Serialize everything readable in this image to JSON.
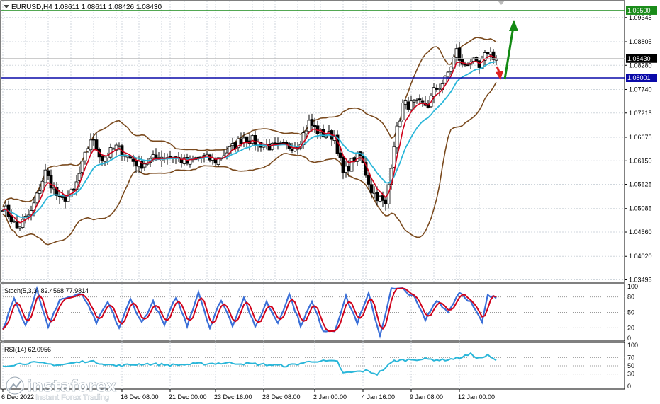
{
  "header": {
    "symbol_info": "EURUSD,H4  1.08611 1.08611 1.08426 1.08430"
  },
  "logo": {
    "brand": "instaforex",
    "tagline": "Instant Forex Trading"
  },
  "colors": {
    "grid": "#cfd6dc",
    "frame": "#000000",
    "bull": "#000000",
    "bear": "#000000",
    "ema_fast": "#d0021b",
    "ema_slow": "#29b6d9",
    "bb": "#7a4a1e",
    "resistance": "#1a8c1a",
    "support": "#0a0aa8",
    "stoch_main": "#3a6fd8",
    "stoch_signal": "#d0021b",
    "rsi": "#29b6d9",
    "arrow_up": "#138a13",
    "arrow_down": "#e02020"
  },
  "price_axis": {
    "ticks": [
      "1.09345",
      "1.08805",
      "1.08280",
      "1.07740",
      "1.07215",
      "1.06675",
      "1.06150",
      "1.05625",
      "1.05085",
      "1.04560",
      "1.04020",
      "1.03495"
    ],
    "tick_values": [
      1.09345,
      1.08805,
      1.0828,
      1.0774,
      1.07215,
      1.06675,
      1.0615,
      1.05625,
      1.05085,
      1.0456,
      1.0402,
      1.03495
    ],
    "ylim": [
      1.0344,
      1.0972
    ]
  },
  "levels": {
    "resistance": {
      "value": 1.095,
      "label": "1.09500"
    },
    "current": {
      "value": 1.0843,
      "label": "1.08430"
    },
    "support": {
      "value": 1.08,
      "label": "1.08001"
    }
  },
  "time_axis": {
    "labels": [
      "6 Dec 2022",
      "16 Dec 08:00",
      "21 Dec 00:00",
      "23 Dec 16:00",
      "28 Dec 08:00",
      "2 Jan 00:00",
      "4 Jan 16:00",
      "9 Jan 08:00",
      "12 Jan 00:00"
    ],
    "positions": [
      0,
      42,
      59,
      75,
      92,
      110,
      127,
      144,
      161
    ]
  },
  "stoch": {
    "label": "Stoch(5,3,3) 82.4568 77.9814",
    "ticks": [
      "100",
      "80",
      "50",
      "20",
      "0"
    ],
    "tick_values": [
      100,
      80,
      50,
      20,
      0
    ]
  },
  "rsi": {
    "label": "RSI(14) 62.0956",
    "ticks": [
      "100",
      "70",
      "50",
      "30",
      "0"
    ],
    "tick_values": [
      100,
      70,
      50,
      30,
      0
    ]
  },
  "chart_data": {
    "type": "candlestick",
    "title": "EURUSD,H4",
    "bars": 175,
    "close_anchor_idx": [
      0,
      5,
      10,
      15,
      20,
      25,
      31,
      35,
      40,
      44,
      48,
      55,
      60,
      65,
      70,
      75,
      80,
      85,
      90,
      95,
      100,
      104,
      108,
      112,
      117,
      120,
      124,
      126,
      130,
      135,
      138,
      141,
      145,
      150,
      152,
      156,
      160,
      162,
      165,
      168,
      171,
      174
    ],
    "close_anchor_val": [
      1.0515,
      1.0465,
      1.05,
      1.059,
      1.0525,
      1.0545,
      1.0665,
      1.062,
      1.0645,
      1.0625,
      1.0605,
      1.0625,
      1.0625,
      1.061,
      1.0625,
      1.0615,
      1.064,
      1.0668,
      1.0655,
      1.0645,
      1.0645,
      1.065,
      1.07,
      1.0675,
      1.067,
      1.0585,
      1.062,
      1.0625,
      1.055,
      1.0515,
      1.0655,
      1.074,
      1.074,
      1.074,
      1.077,
      1.0795,
      1.086,
      1.0825,
      1.084,
      1.082,
      1.086,
      1.0843
    ],
    "stoch_anchor_idx": [
      0,
      4,
      8,
      12,
      16,
      20,
      24,
      28,
      33,
      37,
      41,
      45,
      49,
      53,
      57,
      61,
      65,
      69,
      73,
      77,
      81,
      85,
      89,
      93,
      97,
      101,
      105,
      109,
      113,
      117,
      121,
      125,
      129,
      133,
      137,
      141,
      145,
      149,
      153,
      157,
      161,
      165,
      169,
      171,
      174
    ],
    "stoch_anchor_val": [
      15,
      80,
      25,
      95,
      20,
      75,
      80,
      85,
      30,
      70,
      20,
      75,
      30,
      70,
      25,
      80,
      25,
      90,
      20,
      75,
      25,
      80,
      20,
      70,
      30,
      85,
      25,
      70,
      15,
      15,
      80,
      30,
      85,
      5,
      95,
      95,
      80,
      35,
      75,
      50,
      90,
      70,
      30,
      82,
      78
    ],
    "rsi_anchor_idx": [
      0,
      10,
      20,
      30,
      40,
      50,
      60,
      70,
      80,
      90,
      100,
      110,
      118,
      120,
      128,
      132,
      138,
      145,
      150,
      155,
      160,
      165,
      168,
      171,
      174
    ],
    "rsi_anchor_val": [
      50,
      58,
      52,
      62,
      50,
      55,
      52,
      55,
      57,
      54,
      50,
      62,
      60,
      32,
      38,
      30,
      62,
      66,
      66,
      64,
      68,
      78,
      68,
      75,
      62
    ]
  }
}
